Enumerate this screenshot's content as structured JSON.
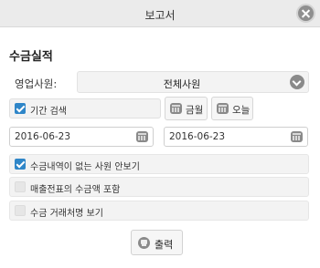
{
  "window": {
    "title": "보고서",
    "close_icon": "close-icon"
  },
  "section": {
    "title": "수금실적"
  },
  "sales_rep": {
    "label": "영업사원:",
    "value": "전체사원"
  },
  "period": {
    "label": "기간 검색",
    "checked": true,
    "this_month_label": "금월",
    "today_label": "오늘",
    "start_date": "2016-06-23",
    "end_date": "2016-06-23"
  },
  "options": [
    {
      "label": "수금내역이 없는 사원 안보기",
      "checked": true
    },
    {
      "label": "매출전표의 수금액 포함",
      "checked": false
    },
    {
      "label": "수금 거래처명 보기",
      "checked": false
    }
  ],
  "actions": {
    "print_label": "출력"
  },
  "colors": {
    "accent": "#2f86c8",
    "icon_gray": "#8a8a8a"
  }
}
